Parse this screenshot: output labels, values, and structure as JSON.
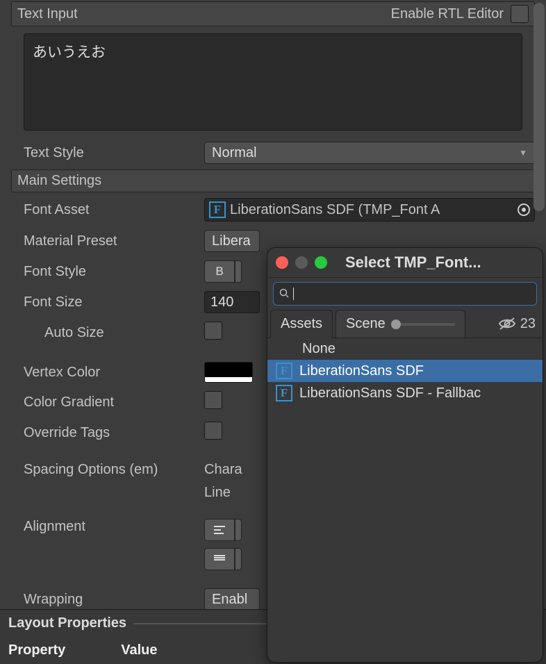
{
  "inspector": {
    "text_input_label": "Text Input",
    "enable_rtl_label": "Enable RTL Editor",
    "text_content": "あいうえお",
    "text_style_label": "Text Style",
    "text_style_value": "Normal",
    "main_settings_label": "Main Settings",
    "font_asset_label": "Font Asset",
    "font_asset_value": "LiberationSans SDF (TMP_Font A",
    "material_preset_label": "Material Preset",
    "material_preset_value": "Libera",
    "font_style_label": "Font Style",
    "font_style_bold": "B",
    "font_size_label": "Font Size",
    "font_size_value": "140",
    "auto_size_label": "Auto Size",
    "vertex_color_label": "Vertex Color",
    "color_gradient_label": "Color Gradient",
    "override_tags_label": "Override Tags",
    "spacing_label": "Spacing Options (em)",
    "spacing_chars": "Chara",
    "spacing_line": "Line",
    "alignment_label": "Alignment",
    "wrapping_label": "Wrapping",
    "wrapping_value": "Enabl"
  },
  "layout": {
    "title": "Layout Properties",
    "col1": "Property",
    "col2": "Value"
  },
  "popup": {
    "title": "Select TMP_Font...",
    "tab_assets": "Assets",
    "tab_scene": "Scene",
    "count": "23",
    "items": [
      {
        "label": "None",
        "icon": false
      },
      {
        "label": "LiberationSans SDF",
        "icon": true,
        "selected": true
      },
      {
        "label": "LiberationSans SDF - Fallbac",
        "icon": true
      }
    ]
  }
}
